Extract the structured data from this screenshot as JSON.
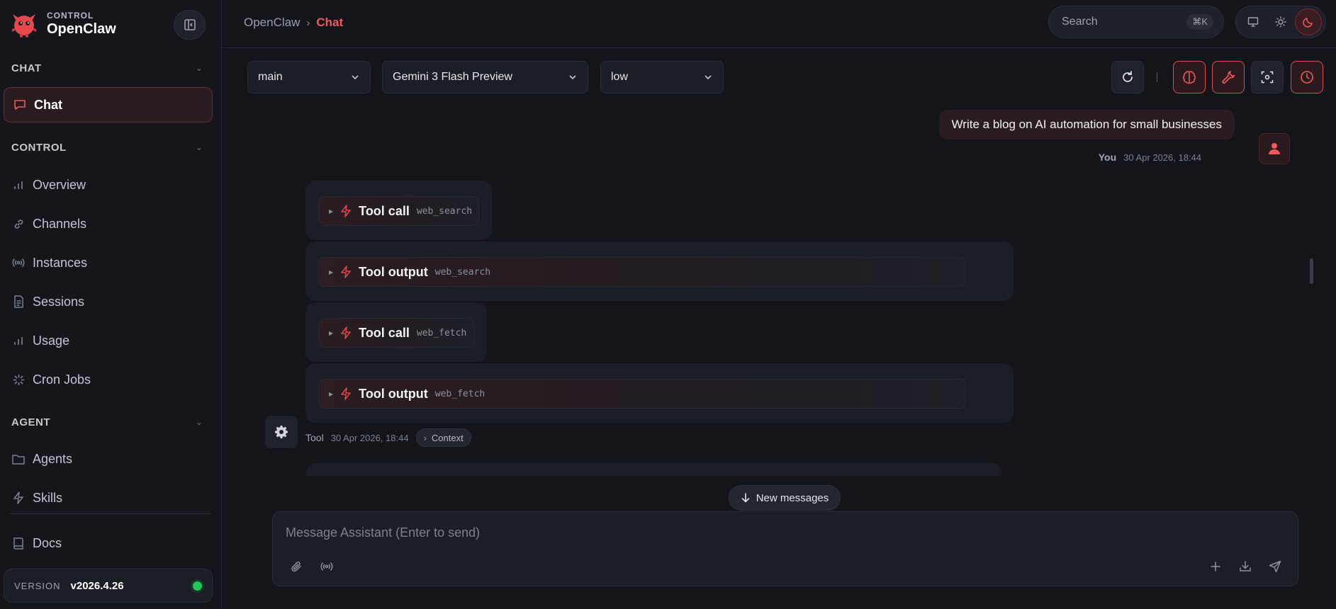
{
  "brand": {
    "sub": "CONTROL",
    "name": "OpenClaw"
  },
  "sidebar": {
    "sections": [
      {
        "title": "CHAT"
      },
      {
        "title": "CONTROL"
      },
      {
        "title": "AGENT"
      }
    ],
    "items": [
      {
        "label": "Chat",
        "icon": "message-square-icon"
      },
      {
        "label": "Overview",
        "icon": "bar-chart-icon"
      },
      {
        "label": "Channels",
        "icon": "link-icon"
      },
      {
        "label": "Instances",
        "icon": "radio-icon"
      },
      {
        "label": "Sessions",
        "icon": "file-text-icon"
      },
      {
        "label": "Usage",
        "icon": "bar-chart-icon"
      },
      {
        "label": "Cron Jobs",
        "icon": "loader-icon"
      },
      {
        "label": "Agents",
        "icon": "folder-icon"
      },
      {
        "label": "Skills",
        "icon": "zap-icon"
      },
      {
        "label": "Docs",
        "icon": "book-icon"
      }
    ],
    "version": {
      "label": "VERSION",
      "value": "v2026.4.26",
      "status": "online"
    }
  },
  "breadcrumb": {
    "root": "OpenClaw",
    "separator": "›",
    "current": "Chat"
  },
  "search": {
    "placeholder": "Search",
    "shortcut": "⌘K"
  },
  "toolbar": {
    "session": "main",
    "model": "Gemini 3 Flash Preview",
    "thinking": "low"
  },
  "messages": {
    "user": {
      "text": "Write a blog on AI automation for small businesses",
      "author": "You",
      "time": "30 Apr 2026, 18:44"
    },
    "tools": [
      {
        "title": "Tool call",
        "name": "web_search"
      },
      {
        "title": "Tool output",
        "name": "web_search"
      },
      {
        "title": "Tool call",
        "name": "web_fetch"
      },
      {
        "title": "Tool output",
        "name": "web_fetch"
      }
    ],
    "tool_meta": {
      "author": "Tool",
      "time": "30 Apr 2026, 18:44",
      "context_label": "Context"
    }
  },
  "new_messages_label": "New messages",
  "composer": {
    "placeholder": "Message Assistant (Enter to send)"
  },
  "colors": {
    "accent": "#f05a5a",
    "background": "#13151b",
    "status_online": "#22c55e"
  }
}
